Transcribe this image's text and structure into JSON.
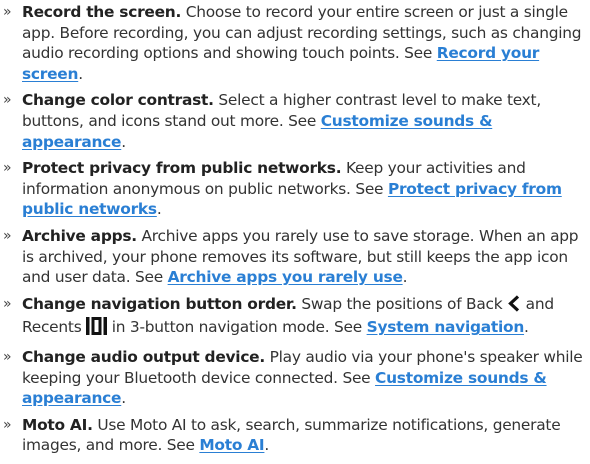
{
  "colors": {
    "text": "#333333",
    "title": "#222222",
    "link": "#2a7fd4"
  },
  "bullet_glyph": "»",
  "items": [
    {
      "title": "Record the screen.",
      "body": " Choose to record your entire screen or just a single app. Before recording, you can adjust recording settings, such as changing audio recording options and showing touch points. See ",
      "link": "Record your screen",
      "end": "."
    },
    {
      "title": "Change color contrast.",
      "body": " Select a higher contrast level to make text, buttons, and icons stand out more. See ",
      "link": "Customize sounds & appearance",
      "end": "."
    },
    {
      "title": "Protect privacy from public networks.",
      "body": " Keep your activities and information anonymous on public networks. See ",
      "link": "Protect privacy from public networks",
      "end": "."
    },
    {
      "title": "Archive apps.",
      "body": " Archive apps you rarely use to save storage. When an app is archived, your phone removes its software, but still keeps the app icon and user data. See ",
      "link": "Archive apps you rarely use",
      "end": "."
    },
    {
      "title": "Change navigation button order.",
      "body_1": " Swap the positions of Back ",
      "back_icon": "back-chevron-icon",
      "body_2": " and Recents ",
      "recents_icon": "recents-icon",
      "body_3": " in 3-button navigation mode. See ",
      "link": "System navigation",
      "end": "."
    },
    {
      "title": "Change audio output device.",
      "body": " Play audio via your phone's speaker while keeping your Bluetooth device connected. See ",
      "link": "Customize sounds & appearance",
      "end": "."
    },
    {
      "title": "Moto AI.",
      "body": " Use Moto AI to ask, search, summarize notifications, generate images, and more. See ",
      "link": "Moto AI",
      "end": "."
    }
  ]
}
